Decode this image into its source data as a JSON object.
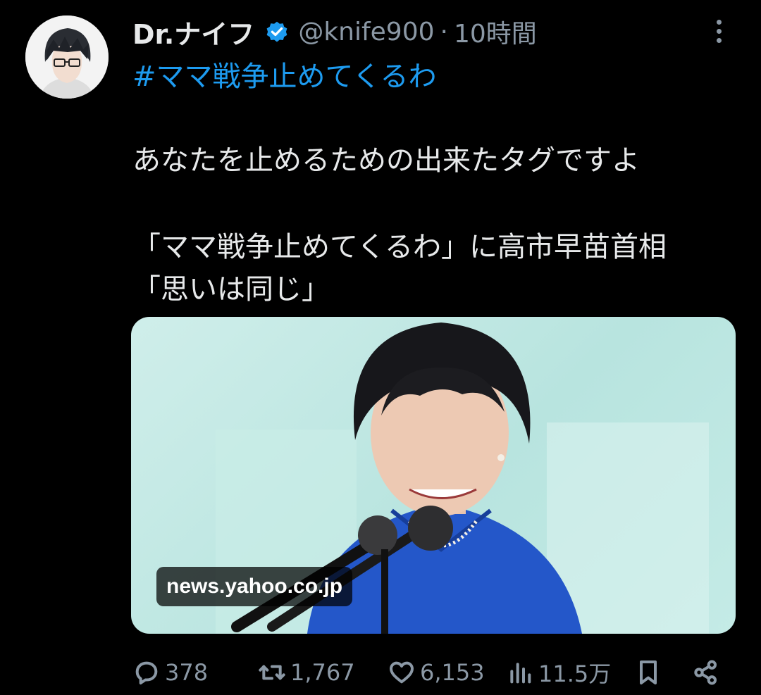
{
  "tweet": {
    "display_name": "Dr.ナイフ",
    "handle": "@knife900",
    "separator": "·",
    "time": "10時間",
    "hashtag": "#ママ戦争止めてくるわ",
    "text_line1": "あなたを止めるための出来たタグですよ",
    "text_line2": "「ママ戦争止めてくるわ」に高市早苗首相",
    "text_line3": "「思いは同じ」"
  },
  "media": {
    "source": "news.yahoo.co.jp"
  },
  "actions": {
    "replies": "378",
    "retweets": "1,767",
    "likes": "6,153",
    "views": "11.5万"
  },
  "icons": {
    "verified": "verified-badge-icon",
    "more": "more-vertical-icon",
    "reply": "reply-icon",
    "retweet": "retweet-icon",
    "like": "heart-icon",
    "views": "views-chart-icon",
    "bookmark": "bookmark-icon",
    "share": "share-icon"
  },
  "colors": {
    "background": "#000000",
    "text": "#e7e9ea",
    "muted": "#8b98a5",
    "accent": "#1d9bf0"
  }
}
